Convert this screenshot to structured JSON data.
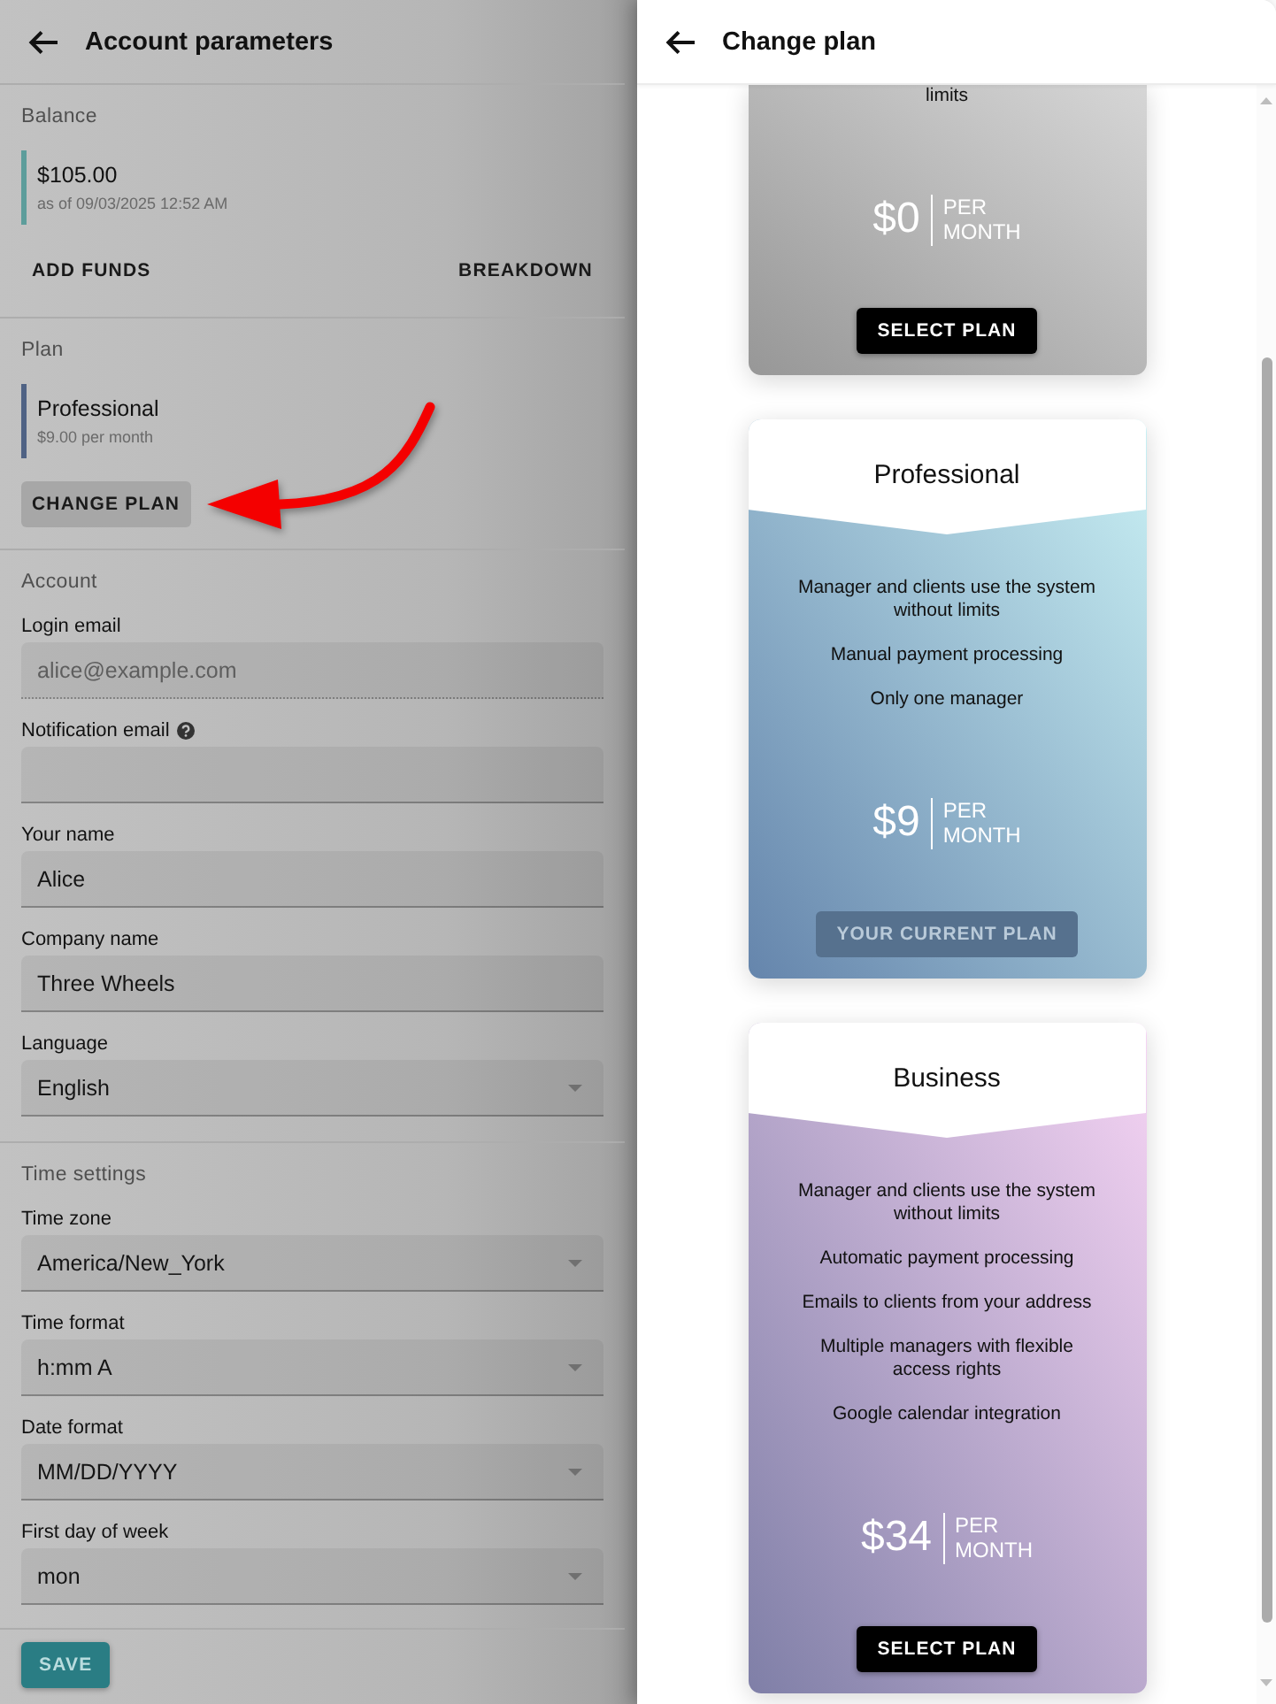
{
  "account_panel": {
    "title": "Account parameters",
    "balance": {
      "heading": "Balance",
      "amount": "$105.00",
      "as_of": "as of 09/03/2025 12:52 AM",
      "actions": [
        "ADD FUNDS",
        "BREAKDOWN"
      ]
    },
    "plan": {
      "heading": "Plan",
      "name": "Professional",
      "price": "$9.00 per month",
      "action": "CHANGE PLAN"
    },
    "sections": [
      {
        "heading": "Account",
        "fields": [
          {
            "label": "Login email",
            "kind": "text",
            "value": "alice@example.com",
            "disabled": true
          },
          {
            "label": "Notification email",
            "kind": "text",
            "help": true,
            "disabled": false
          },
          {
            "label": "Your name",
            "kind": "text",
            "value": "Alice",
            "disabled": false
          },
          {
            "label": "Company name",
            "kind": "text",
            "value": "Three Wheels",
            "disabled": false
          },
          {
            "label": "Language",
            "kind": "select",
            "value": "English",
            "disabled": false
          }
        ]
      },
      {
        "heading": "Time settings",
        "fields": [
          {
            "label": "Time zone",
            "kind": "select",
            "value": "America/New_York",
            "disabled": false
          },
          {
            "label": "Time format",
            "kind": "select",
            "value": "h:mm A",
            "disabled": false
          },
          {
            "label": "Date format",
            "kind": "select",
            "value": "MM/DD/YYYY",
            "disabled": false
          },
          {
            "label": "First day of week",
            "kind": "select",
            "value": "mon",
            "disabled": false
          }
        ]
      }
    ],
    "save": "SAVE"
  },
  "change_plan_panel": {
    "title": "Change plan",
    "plans": [
      {
        "features": [
          "limits"
        ],
        "price": "$0",
        "period": "PER MONTH",
        "button": "SELECT PLAN",
        "current": false
      },
      {
        "title": "Professional",
        "features": [
          "Manager and clients use the system without limits",
          "Manual payment processing",
          "Only one manager"
        ],
        "price": "$9",
        "period": "PER MONTH",
        "button": "YOUR CURRENT PLAN",
        "current": true
      },
      {
        "title": "Business",
        "features": [
          "Manager and clients use the system without limits",
          "Automatic payment processing",
          "Emails to clients from your address",
          "Multiple managers with flexible access rights",
          "Google calendar integration"
        ],
        "price": "$34",
        "period": "PER MONTH",
        "button": "SELECT PLAN",
        "current": false
      }
    ]
  }
}
